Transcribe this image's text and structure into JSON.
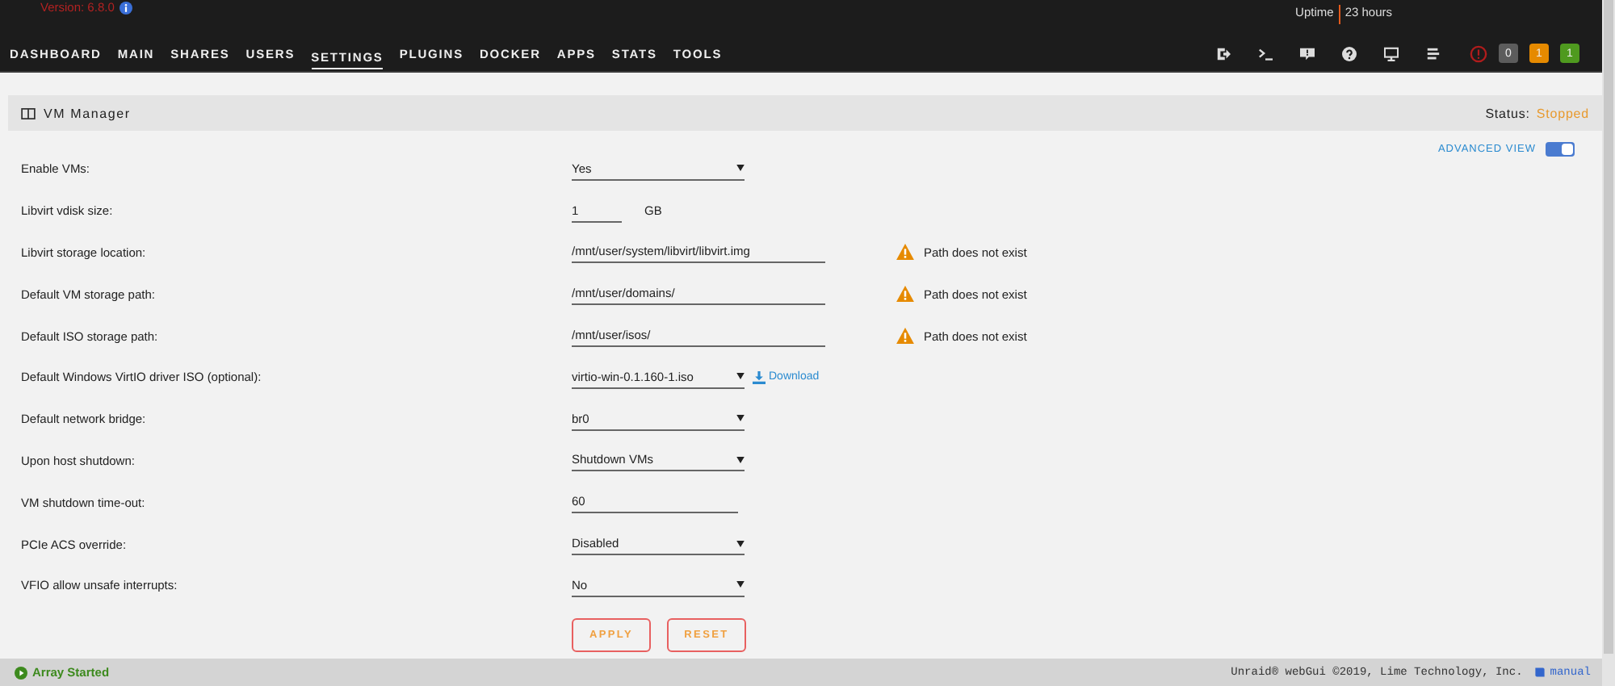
{
  "header": {
    "version": "Version: 6.8.0",
    "uptime_label": "Uptime",
    "uptime": "23 hours"
  },
  "nav": [
    {
      "label": "DASHBOARD",
      "selected": false
    },
    {
      "label": "MAIN",
      "selected": false
    },
    {
      "label": "SHARES",
      "selected": false
    },
    {
      "label": "USERS",
      "selected": false
    },
    {
      "label": "SETTINGS",
      "selected": true
    },
    {
      "label": "PLUGINS",
      "selected": false
    },
    {
      "label": "DOCKER",
      "selected": false
    },
    {
      "label": "APPS",
      "selected": false
    },
    {
      "label": "STATS",
      "selected": false
    },
    {
      "label": "TOOLS",
      "selected": false
    }
  ],
  "badges": [
    {
      "count": "0",
      "color": "#5c5c5c"
    },
    {
      "count": "1",
      "color": "#e68a00"
    },
    {
      "count": "1",
      "color": "#4f9a1f"
    }
  ],
  "panel": {
    "title": "VM Manager",
    "status_label": "Status:",
    "status": "Stopped"
  },
  "advanced_view": {
    "label": "ADVANCED VIEW",
    "on": true
  },
  "settings": [
    {
      "label": "Enable VMs:",
      "kind": "select",
      "value": "Yes"
    },
    {
      "label": "Libvirt vdisk size:",
      "kind": "number",
      "value": "1",
      "unit": "GB"
    },
    {
      "label": "Libvirt storage location:",
      "kind": "path",
      "value": "/mnt/user/system/libvirt/libvirt.img",
      "warning": "Path does not exist"
    },
    {
      "label": "Default VM storage path:",
      "kind": "path",
      "value": "/mnt/user/domains/",
      "warning": "Path does not exist"
    },
    {
      "label": "Default ISO storage path:",
      "kind": "path",
      "value": "/mnt/user/isos/",
      "warning": "Path does not exist"
    },
    {
      "label": "Default Windows VirtIO driver ISO (optional):",
      "kind": "select",
      "value": "virtio-win-0.1.160-1.iso",
      "link": "Download"
    },
    {
      "label": "Default network bridge:",
      "kind": "select",
      "value": "br0"
    },
    {
      "label": "Upon host shutdown:",
      "kind": "select",
      "value": "Shutdown VMs"
    },
    {
      "label": "VM shutdown time-out:",
      "kind": "text",
      "value": "60"
    },
    {
      "label": "PCIe ACS override:",
      "kind": "select",
      "value": "Disabled"
    },
    {
      "label": "VFIO allow unsafe interrupts:",
      "kind": "select",
      "value": "No"
    }
  ],
  "buttons": [
    "APPLY",
    "RESET"
  ],
  "status_bar": {
    "array": "Array Started",
    "copyright": "Unraid® webGui ©2019, Lime Technology, Inc.",
    "manual": "manual"
  }
}
